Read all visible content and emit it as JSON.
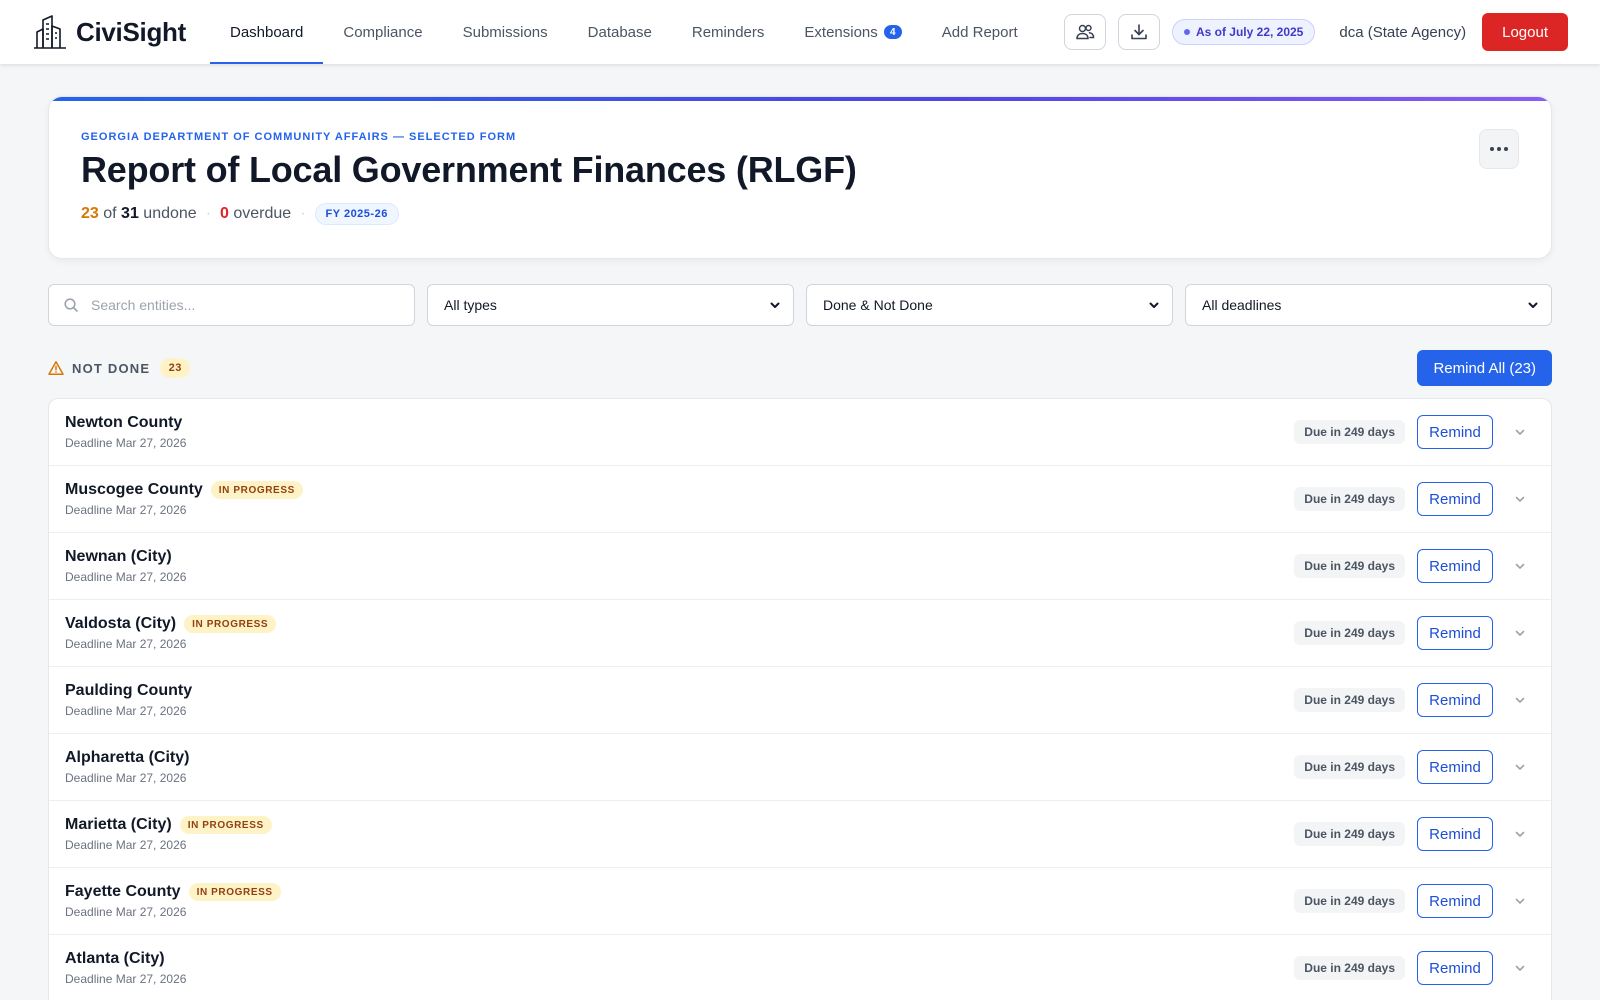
{
  "brand": {
    "name": "CiviSight"
  },
  "nav": {
    "items": [
      {
        "label": "Dashboard",
        "active": true
      },
      {
        "label": "Compliance"
      },
      {
        "label": "Submissions"
      },
      {
        "label": "Database"
      },
      {
        "label": "Reminders"
      },
      {
        "label": "Extensions",
        "badge": "4"
      },
      {
        "label": "Add Report"
      }
    ]
  },
  "toolbar": {
    "users_icon": "users-icon",
    "download_icon": "download-icon",
    "as_of": "As of July 22, 2025",
    "user": "dca (State Agency)",
    "logout_label": "Logout"
  },
  "header": {
    "eyebrow": "GEORGIA DEPARTMENT OF COMMUNITY AFFAIRS — SELECTED FORM",
    "title": "Report of Local Government Finances (RLGF)",
    "undone": "23",
    "of_label": "of",
    "total": "31",
    "undone_label": "undone",
    "overdue": "0",
    "overdue_label": "overdue",
    "fiscal_year": "FY 2025-26"
  },
  "filters": {
    "search_placeholder": "Search entities...",
    "type": "All types",
    "status": "Done & Not Done",
    "deadline": "All deadlines"
  },
  "section": {
    "label": "NOT DONE",
    "count": "23",
    "remind_all_label": "Remind All (23)"
  },
  "rows": [
    {
      "name": "Newton County",
      "status": "",
      "deadline": "Deadline Mar 27, 2026",
      "due": "Due in 249 days",
      "action": "Remind"
    },
    {
      "name": "Muscogee County",
      "status": "IN PROGRESS",
      "deadline": "Deadline Mar 27, 2026",
      "due": "Due in 249 days",
      "action": "Remind"
    },
    {
      "name": "Newnan (City)",
      "status": "",
      "deadline": "Deadline Mar 27, 2026",
      "due": "Due in 249 days",
      "action": "Remind"
    },
    {
      "name": "Valdosta (City)",
      "status": "IN PROGRESS",
      "deadline": "Deadline Mar 27, 2026",
      "due": "Due in 249 days",
      "action": "Remind"
    },
    {
      "name": "Paulding County",
      "status": "",
      "deadline": "Deadline Mar 27, 2026",
      "due": "Due in 249 days",
      "action": "Remind"
    },
    {
      "name": "Alpharetta (City)",
      "status": "",
      "deadline": "Deadline Mar 27, 2026",
      "due": "Due in 249 days",
      "action": "Remind"
    },
    {
      "name": "Marietta (City)",
      "status": "IN PROGRESS",
      "deadline": "Deadline Mar 27, 2026",
      "due": "Due in 249 days",
      "action": "Remind"
    },
    {
      "name": "Fayette County",
      "status": "IN PROGRESS",
      "deadline": "Deadline Mar 27, 2026",
      "due": "Due in 249 days",
      "action": "Remind"
    },
    {
      "name": "Atlanta (City)",
      "status": "",
      "deadline": "Deadline Mar 27, 2026",
      "due": "Due in 249 days",
      "action": "Remind"
    }
  ],
  "colors": {
    "accent": "#2563eb",
    "danger": "#dc2626",
    "warning": "#d97706",
    "badge_bg": "#fef3c7"
  }
}
